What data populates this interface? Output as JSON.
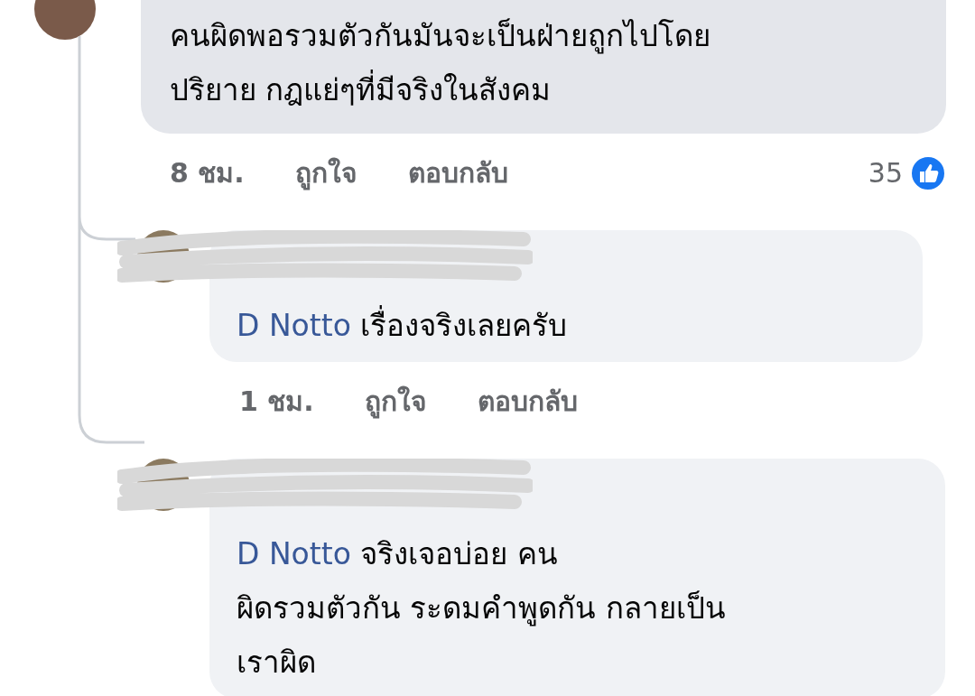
{
  "comment": {
    "text_lines": [
      "คนผิดพอรวมตัวกันมันจะเป็นฝ่ายถูกไปโดย",
      "ปริยาย กฎแย่ๆที่มีจริงในสังคม"
    ],
    "time": "8 ชม.",
    "like_label": "ถูกใจ",
    "reply_label": "ตอบกลับ",
    "reaction_count": "35"
  },
  "replies": [
    {
      "mention": "D Notto",
      "text_lines": [
        "เรื่องจริงเลยครับ"
      ],
      "time": "1 ชม.",
      "like_label": "ถูกใจ",
      "reply_label": "ตอบกลับ"
    },
    {
      "mention": "D Notto",
      "text_lines": [
        "จริงเจอบ่อย คน",
        "ผิดรวมตัวกัน ระดมคำพูดกัน กลายเป็น",
        "เราผิด"
      ]
    }
  ]
}
